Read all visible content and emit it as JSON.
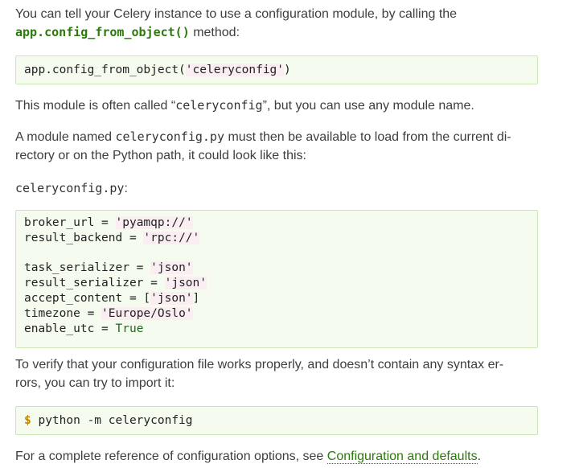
{
  "intro": {
    "text_before": "You can tell your Celery instance to use a configuration module, by calling the",
    "code": "app.config_from_object()",
    "text_after": " method:"
  },
  "code_block_1": {
    "line": "app.config_from_object('celeryconfig')",
    "prefix": "app.config_from_object(",
    "string": "'celeryconfig'",
    "suffix": ")"
  },
  "para_module_name": {
    "before": "This module is often called “",
    "code": "celeryconfig",
    "after": "”, but you can use any module name."
  },
  "para_load": {
    "before": "A module named ",
    "code": "celeryconfig.py",
    "after_line1": " must then be available to load from the current di-",
    "line2": "rectory or on the Python path, it could look like this:"
  },
  "filename_label": {
    "code": "celeryconfig.py",
    "suffix": ":"
  },
  "code_block_2": {
    "lines": [
      {
        "name": "broker_url",
        "op": " = ",
        "value": "'pyamqp://'",
        "type": "string"
      },
      {
        "name": "result_backend",
        "op": " = ",
        "value": "'rpc://'",
        "type": "string"
      },
      {
        "name": "",
        "op": "",
        "value": "",
        "type": "blank"
      },
      {
        "name": "task_serializer",
        "op": " = ",
        "value": "'json'",
        "type": "string"
      },
      {
        "name": "result_serializer",
        "op": " = ",
        "value": "'json'",
        "type": "string"
      },
      {
        "name": "accept_content",
        "op": " = ",
        "value": "['json']",
        "type": "list"
      },
      {
        "name": "timezone",
        "op": " = ",
        "value": "'Europe/Oslo'",
        "type": "string"
      },
      {
        "name": "enable_utc",
        "op": " = ",
        "value": "True",
        "type": "keyword"
      }
    ]
  },
  "para_verify": {
    "line1": "To verify that your configuration file works properly, and doesn’t contain any syntax er-",
    "line2": "rors, you can try to import it:"
  },
  "code_block_3": {
    "prompt": "$",
    "command": " python -m celeryconfig"
  },
  "para_reference": {
    "before": "For a complete reference of configuration options, see ",
    "link": "Configuration and defaults",
    "after": "."
  },
  "colors": {
    "code_bg": "#f5fbef",
    "code_border": "#c9e6b3",
    "link": "#2b7a0b",
    "string_bg": "#fbeef2",
    "prompt": "#b8860b"
  }
}
